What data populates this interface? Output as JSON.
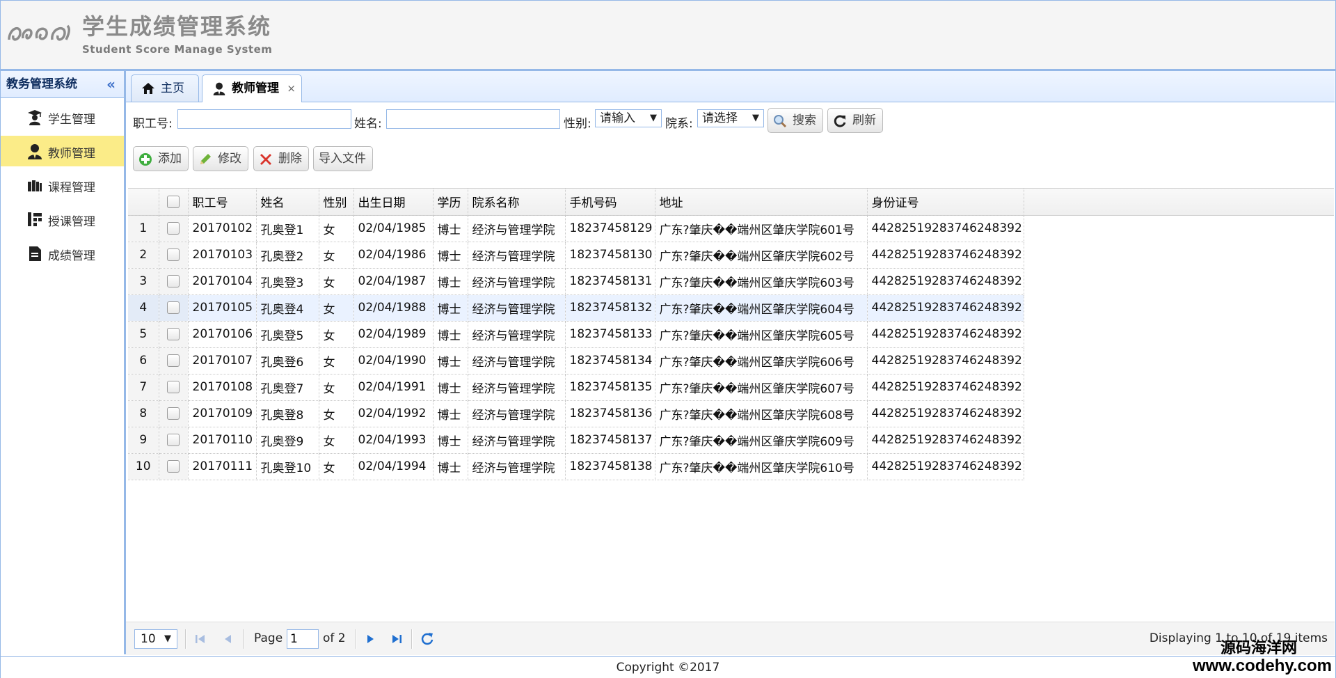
{
  "header": {
    "title": "学生成绩管理系统",
    "subtitle": "Student Score Manage System"
  },
  "sidebar": {
    "title": "教务管理系统",
    "items": [
      {
        "label": "学生管理",
        "icon": "student-cap-icon"
      },
      {
        "label": "教师管理",
        "icon": "teacher-icon",
        "active": true
      },
      {
        "label": "课程管理",
        "icon": "books-icon"
      },
      {
        "label": "授课管理",
        "icon": "hierarchy-icon"
      },
      {
        "label": "成绩管理",
        "icon": "score-document-icon"
      }
    ]
  },
  "tabs": [
    {
      "label": "主页",
      "icon": "home-icon"
    },
    {
      "label": "教师管理",
      "icon": "teacher-icon",
      "active": true,
      "close": "×"
    }
  ],
  "search": {
    "id_label": "职工号:",
    "id_value": "",
    "name_label": "姓名:",
    "name_value": "",
    "gender_label": "性别:",
    "gender_value": "请输入",
    "dept_label": "院系:",
    "dept_value": "请选择",
    "search_button": "搜索",
    "refresh_button": "刷新"
  },
  "toolbar": {
    "add": "添加",
    "edit": "修改",
    "delete": "删除",
    "import": "导入文件"
  },
  "grid": {
    "columns": [
      "职工号",
      "姓名",
      "性别",
      "出生日期",
      "学历",
      "院系名称",
      "手机号码",
      "地址",
      "身份证号"
    ],
    "rows": [
      [
        "1",
        "20170102",
        "孔奥登1",
        "女",
        "02/04/1985",
        "博士",
        "经济与管理学院",
        "18237458129",
        "广东?肇庆��端州区肇庆学院601号",
        "442825192837462483​92"
      ],
      [
        "2",
        "20170103",
        "孔奥登2",
        "女",
        "02/04/1986",
        "博士",
        "经济与管理学院",
        "18237458130",
        "广东?肇庆��端州区肇庆学院602号",
        "442825192837462483​92"
      ],
      [
        "3",
        "20170104",
        "孔奥登3",
        "女",
        "02/04/1987",
        "博士",
        "经济与管理学院",
        "18237458131",
        "广东?肇庆��端州区肇庆学院603号",
        "442825192837462483​92"
      ],
      [
        "4",
        "20170105",
        "孔奥登4",
        "女",
        "02/04/1988",
        "博士",
        "经济与管理学院",
        "18237458132",
        "广东?肇庆��端州区肇庆学院604号",
        "442825192837462483​92"
      ],
      [
        "5",
        "20170106",
        "孔奥登5",
        "女",
        "02/04/1989",
        "博士",
        "经济与管理学院",
        "18237458133",
        "广东?肇庆��端州区肇庆学院605号",
        "442825192837462483​92"
      ],
      [
        "6",
        "20170107",
        "孔奥登6",
        "女",
        "02/04/1990",
        "博士",
        "经济与管理学院",
        "18237458134",
        "广东?肇庆��端州区肇庆学院606号",
        "442825192837462483​92"
      ],
      [
        "7",
        "20170108",
        "孔奥登7",
        "女",
        "02/04/1991",
        "博士",
        "经济与管理学院",
        "18237458135",
        "广东?肇庆��端州区肇庆学院607号",
        "442825192837462483​92"
      ],
      [
        "8",
        "20170109",
        "孔奥登8",
        "女",
        "02/04/1992",
        "博士",
        "经济与管理学院",
        "18237458136",
        "广东?肇庆��端州区肇庆学院608号",
        "442825192837462483​92"
      ],
      [
        "9",
        "20170110",
        "孔奥登9",
        "女",
        "02/04/1993",
        "博士",
        "经济与管理学院",
        "18237458137",
        "广东?肇庆��端州区肇庆学院609号",
        "442825192837462483​92"
      ],
      [
        "10",
        "20170111",
        "孔奥登10",
        "女",
        "02/04/1994",
        "博士",
        "经济与管理学院",
        "18237458138",
        "广东?肇庆��端州区肇庆学院610号",
        "442825192837462483​92"
      ]
    ],
    "highlighted_row": 4
  },
  "pager": {
    "page_size": "10",
    "page_label": "Page",
    "page_value": "1",
    "of_label": "of 2",
    "display_text": "Displaying 1 to 10 of 19 items"
  },
  "footer": {
    "copyright": "Copyright ©2017"
  },
  "watermark": {
    "line1": "源码海洋网",
    "line2": "www.codehy.com"
  }
}
